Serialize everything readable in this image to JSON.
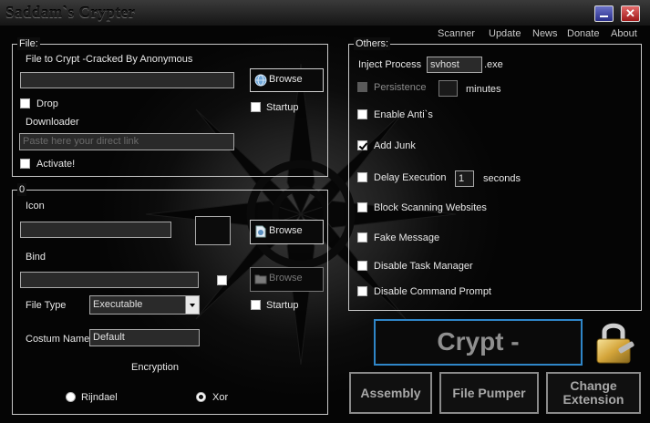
{
  "app": {
    "title": "Saddam`s Crypter",
    "window_controls": {
      "close_glyph": "✕"
    }
  },
  "menu": [
    "Scanner",
    "Update",
    "News",
    "Donate",
    "About"
  ],
  "file_group": {
    "title": "File:",
    "file_label": "File to Crypt -Cracked By Anonymous",
    "file_path": "",
    "browse_label": "Browse",
    "drop_label": "Drop",
    "startup_label": "Startup",
    "downloader_label": "Downloader",
    "link_placeholder": "Paste here your direct link",
    "activate_label": "Activate!"
  },
  "options_group": {
    "title": "0",
    "icon_label": "Icon",
    "icon_path": "",
    "icon_browse_label": "Browse",
    "bind_label": "Bind",
    "bind_path": "",
    "bind_browse_label": "Browse",
    "startup_label": "Startup",
    "file_type_label": "File Type",
    "file_type_value": "Executable",
    "costum_name_label": "Costum Name",
    "costum_name_value": "Default",
    "encryption_label": "Encryption",
    "radio_rijndael": "Rijndael",
    "radio_xor": "Xor",
    "selected_encryption": "Xor"
  },
  "others_group": {
    "title": "Others:",
    "inject_label": "Inject Process",
    "inject_value": "svhost",
    "inject_ext": ".exe",
    "persistence_label": "Persistence",
    "persistence_value": "",
    "minutes_label": "minutes",
    "enable_anti_label": "Enable Anti`s",
    "add_junk_label": "Add Junk",
    "delay_label": "Delay Execution",
    "delay_value": "1",
    "seconds_label": "seconds",
    "block_scan_label": "Block Scanning Websites",
    "fake_msg_label": "Fake Message",
    "disable_tm_label": "Disable Task Manager",
    "disable_cmd_label": "Disable Command Prompt"
  },
  "actions": {
    "crypt_label": "Crypt -",
    "assembly_label": "Assembly",
    "file_pumper_label": "File Pumper",
    "change_ext_line1": "Change",
    "change_ext_line2": "Extension"
  },
  "icons": [
    "minimize-icon",
    "close-icon",
    "globe-icon",
    "document-icon",
    "folder-icon",
    "padlock-icon",
    "tribal-star-decoration"
  ],
  "colors": {
    "crypt_border": "#2f86c8",
    "background": "#0d0d0d",
    "minimize_blue": "#3a40a8",
    "close_red": "#c02a2a"
  }
}
